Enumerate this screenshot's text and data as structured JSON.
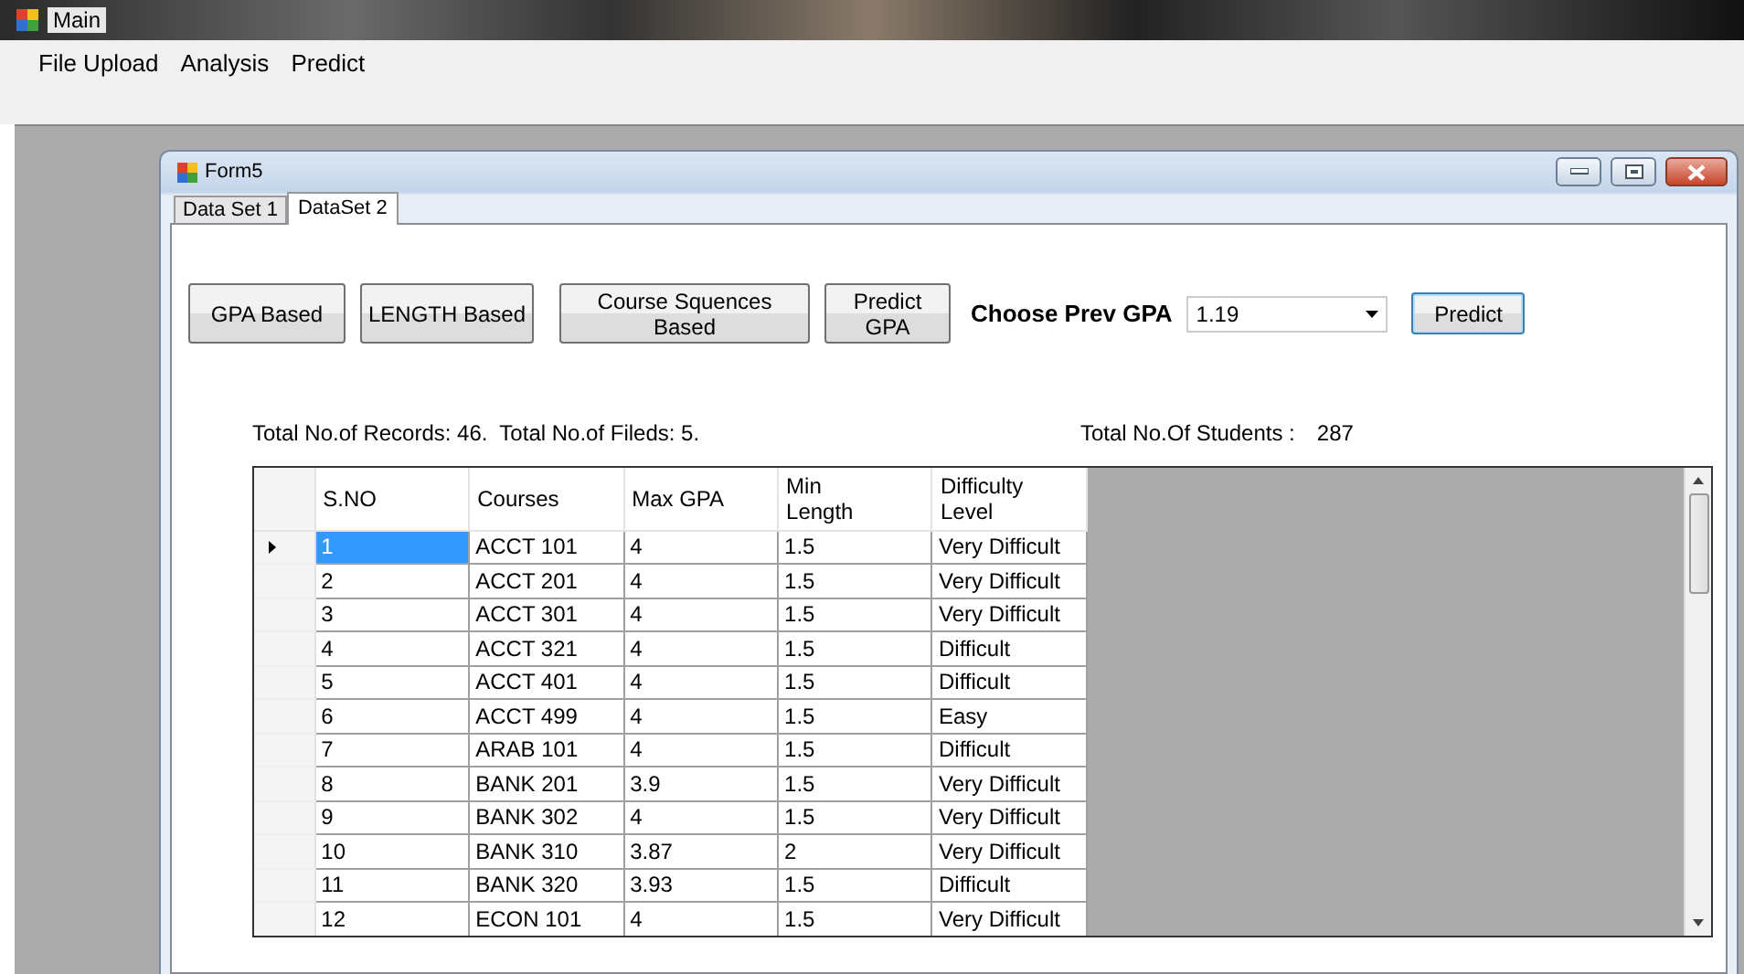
{
  "window": {
    "title": "Main"
  },
  "menu": [
    "File Upload",
    "Analysis",
    "Predict"
  ],
  "child_window": {
    "title": "Form5"
  },
  "tabs": [
    {
      "label": "Data Set 1",
      "selected": false
    },
    {
      "label": "DataSet 2",
      "selected": true
    }
  ],
  "buttons": [
    "GPA Based",
    "LENGTH Based",
    "Course Squences\nBased",
    "Predict\nGPA"
  ],
  "prev_gpa": {
    "label": "Choose Prev GPA",
    "value": "1.19"
  },
  "predict_button": "Predict",
  "summary": "Total No.of Records: 46.  Total No.of Fileds: 5.",
  "students": {
    "label": "Total No.Of Students :",
    "value": "287"
  },
  "table": {
    "columns": [
      "S.NO",
      "Courses",
      "Max GPA",
      "Min\nLength",
      "Difficulty\nLevel"
    ],
    "rows": [
      {
        "selected": true,
        "cells": [
          "1",
          "ACCT 101",
          "4",
          "1.5",
          "Very Difficult"
        ]
      },
      {
        "selected": false,
        "cells": [
          "2",
          "ACCT 201",
          "4",
          "1.5",
          "Very Difficult"
        ]
      },
      {
        "selected": false,
        "cells": [
          "3",
          "ACCT 301",
          "4",
          "1.5",
          "Very Difficult"
        ]
      },
      {
        "selected": false,
        "cells": [
          "4",
          "ACCT 321",
          "4",
          "1.5",
          "Difficult"
        ]
      },
      {
        "selected": false,
        "cells": [
          "5",
          "ACCT 401",
          "4",
          "1.5",
          "Difficult"
        ]
      },
      {
        "selected": false,
        "cells": [
          "6",
          "ACCT 499",
          "4",
          "1.5",
          "Easy"
        ]
      },
      {
        "selected": false,
        "cells": [
          "7",
          "ARAB 101",
          "4",
          "1.5",
          "Difficult"
        ]
      },
      {
        "selected": false,
        "cells": [
          "8",
          "BANK 201",
          "3.9",
          "1.5",
          "Very Difficult"
        ]
      },
      {
        "selected": false,
        "cells": [
          "9",
          "BANK 302",
          "4",
          "1.5",
          "Very Difficult"
        ]
      },
      {
        "selected": false,
        "cells": [
          "10",
          "BANK 310",
          "3.87",
          "2",
          "Very Difficult"
        ]
      },
      {
        "selected": false,
        "cells": [
          "11",
          "BANK 320",
          "3.93",
          "1.5",
          "Difficult"
        ]
      },
      {
        "selected": false,
        "cells": [
          "12",
          "ECON 101",
          "4",
          "1.5",
          "Very Difficult"
        ]
      }
    ]
  }
}
